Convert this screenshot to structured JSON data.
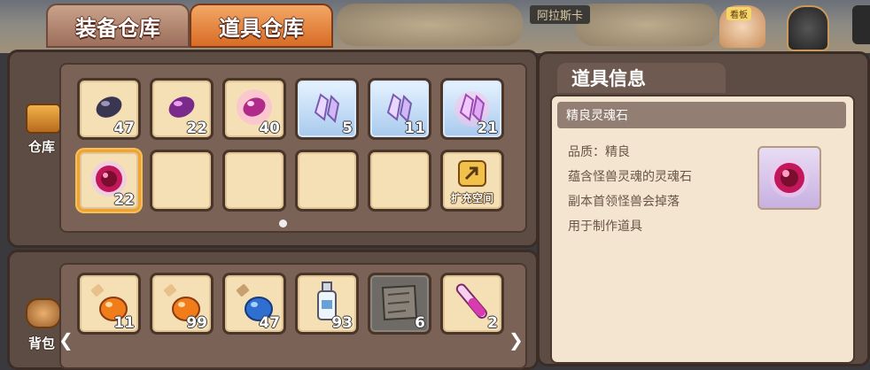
{
  "tabs": {
    "equipment_label": "装备仓库",
    "items_label": "道具仓库"
  },
  "top_bar": {
    "city_label": "阿拉斯卡",
    "npc_badge": "看板"
  },
  "warehouse": {
    "label": "仓库",
    "slots": [
      {
        "item": "dark-gem-icon",
        "count": "47",
        "style": "normal"
      },
      {
        "item": "purple-gem-icon",
        "count": "22",
        "style": "normal"
      },
      {
        "item": "glowing-gem-icon",
        "count": "40",
        "style": "normal"
      },
      {
        "item": "crystal-icon",
        "count": "5",
        "style": "blue"
      },
      {
        "item": "crystal-icon",
        "count": "11",
        "style": "blue"
      },
      {
        "item": "glowing-crystal-icon",
        "count": "21",
        "style": "blue"
      },
      {
        "item": "soul-stone-icon",
        "count": "22",
        "style": "selected"
      },
      {
        "item": "",
        "count": "",
        "style": "normal"
      },
      {
        "item": "",
        "count": "",
        "style": "normal"
      },
      {
        "item": "",
        "count": "",
        "style": "normal"
      },
      {
        "item": "",
        "count": "",
        "style": "normal"
      },
      {
        "item": "expand-icon",
        "count": "",
        "style": "normal"
      }
    ],
    "expand_label": "扩充空间"
  },
  "backpack": {
    "label": "背包",
    "slots": [
      {
        "item": "orange-potion-icon",
        "count": "11",
        "style": "normal"
      },
      {
        "item": "orange-potion-icon",
        "count": "99",
        "style": "normal"
      },
      {
        "item": "blue-potion-icon",
        "count": "47",
        "style": "normal"
      },
      {
        "item": "white-bottle-icon",
        "count": "93",
        "style": "normal"
      },
      {
        "item": "map-scroll-icon",
        "count": "6",
        "style": "gray"
      },
      {
        "item": "pink-vial-icon",
        "count": "2",
        "style": "normal"
      }
    ]
  },
  "info": {
    "title": "道具信息",
    "item_name": "精良灵魂石",
    "lines": [
      "品质：精良",
      "蕴含怪兽灵魂的灵魂石",
      "副本首领怪兽会掉落",
      "用于制作道具"
    ]
  },
  "colors": {
    "active_tab": "#d86b26",
    "panel": "#5d4c44",
    "slot": "#f5dfb5",
    "selected_border": "#f0a232"
  }
}
